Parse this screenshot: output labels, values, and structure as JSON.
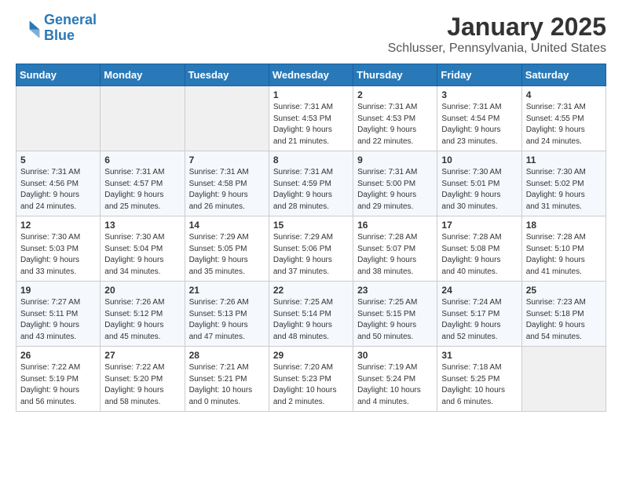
{
  "header": {
    "logo_line1": "General",
    "logo_line2": "Blue",
    "title": "January 2025",
    "subtitle": "Schlusser, Pennsylvania, United States"
  },
  "days_of_week": [
    "Sunday",
    "Monday",
    "Tuesday",
    "Wednesday",
    "Thursday",
    "Friday",
    "Saturday"
  ],
  "weeks": [
    [
      {
        "day": "",
        "content": ""
      },
      {
        "day": "",
        "content": ""
      },
      {
        "day": "",
        "content": ""
      },
      {
        "day": "1",
        "content": "Sunrise: 7:31 AM\nSunset: 4:53 PM\nDaylight: 9 hours\nand 21 minutes."
      },
      {
        "day": "2",
        "content": "Sunrise: 7:31 AM\nSunset: 4:53 PM\nDaylight: 9 hours\nand 22 minutes."
      },
      {
        "day": "3",
        "content": "Sunrise: 7:31 AM\nSunset: 4:54 PM\nDaylight: 9 hours\nand 23 minutes."
      },
      {
        "day": "4",
        "content": "Sunrise: 7:31 AM\nSunset: 4:55 PM\nDaylight: 9 hours\nand 24 minutes."
      }
    ],
    [
      {
        "day": "5",
        "content": "Sunrise: 7:31 AM\nSunset: 4:56 PM\nDaylight: 9 hours\nand 24 minutes."
      },
      {
        "day": "6",
        "content": "Sunrise: 7:31 AM\nSunset: 4:57 PM\nDaylight: 9 hours\nand 25 minutes."
      },
      {
        "day": "7",
        "content": "Sunrise: 7:31 AM\nSunset: 4:58 PM\nDaylight: 9 hours\nand 26 minutes."
      },
      {
        "day": "8",
        "content": "Sunrise: 7:31 AM\nSunset: 4:59 PM\nDaylight: 9 hours\nand 28 minutes."
      },
      {
        "day": "9",
        "content": "Sunrise: 7:31 AM\nSunset: 5:00 PM\nDaylight: 9 hours\nand 29 minutes."
      },
      {
        "day": "10",
        "content": "Sunrise: 7:30 AM\nSunset: 5:01 PM\nDaylight: 9 hours\nand 30 minutes."
      },
      {
        "day": "11",
        "content": "Sunrise: 7:30 AM\nSunset: 5:02 PM\nDaylight: 9 hours\nand 31 minutes."
      }
    ],
    [
      {
        "day": "12",
        "content": "Sunrise: 7:30 AM\nSunset: 5:03 PM\nDaylight: 9 hours\nand 33 minutes."
      },
      {
        "day": "13",
        "content": "Sunrise: 7:30 AM\nSunset: 5:04 PM\nDaylight: 9 hours\nand 34 minutes."
      },
      {
        "day": "14",
        "content": "Sunrise: 7:29 AM\nSunset: 5:05 PM\nDaylight: 9 hours\nand 35 minutes."
      },
      {
        "day": "15",
        "content": "Sunrise: 7:29 AM\nSunset: 5:06 PM\nDaylight: 9 hours\nand 37 minutes."
      },
      {
        "day": "16",
        "content": "Sunrise: 7:28 AM\nSunset: 5:07 PM\nDaylight: 9 hours\nand 38 minutes."
      },
      {
        "day": "17",
        "content": "Sunrise: 7:28 AM\nSunset: 5:08 PM\nDaylight: 9 hours\nand 40 minutes."
      },
      {
        "day": "18",
        "content": "Sunrise: 7:28 AM\nSunset: 5:10 PM\nDaylight: 9 hours\nand 41 minutes."
      }
    ],
    [
      {
        "day": "19",
        "content": "Sunrise: 7:27 AM\nSunset: 5:11 PM\nDaylight: 9 hours\nand 43 minutes."
      },
      {
        "day": "20",
        "content": "Sunrise: 7:26 AM\nSunset: 5:12 PM\nDaylight: 9 hours\nand 45 minutes."
      },
      {
        "day": "21",
        "content": "Sunrise: 7:26 AM\nSunset: 5:13 PM\nDaylight: 9 hours\nand 47 minutes."
      },
      {
        "day": "22",
        "content": "Sunrise: 7:25 AM\nSunset: 5:14 PM\nDaylight: 9 hours\nand 48 minutes."
      },
      {
        "day": "23",
        "content": "Sunrise: 7:25 AM\nSunset: 5:15 PM\nDaylight: 9 hours\nand 50 minutes."
      },
      {
        "day": "24",
        "content": "Sunrise: 7:24 AM\nSunset: 5:17 PM\nDaylight: 9 hours\nand 52 minutes."
      },
      {
        "day": "25",
        "content": "Sunrise: 7:23 AM\nSunset: 5:18 PM\nDaylight: 9 hours\nand 54 minutes."
      }
    ],
    [
      {
        "day": "26",
        "content": "Sunrise: 7:22 AM\nSunset: 5:19 PM\nDaylight: 9 hours\nand 56 minutes."
      },
      {
        "day": "27",
        "content": "Sunrise: 7:22 AM\nSunset: 5:20 PM\nDaylight: 9 hours\nand 58 minutes."
      },
      {
        "day": "28",
        "content": "Sunrise: 7:21 AM\nSunset: 5:21 PM\nDaylight: 10 hours\nand 0 minutes."
      },
      {
        "day": "29",
        "content": "Sunrise: 7:20 AM\nSunset: 5:23 PM\nDaylight: 10 hours\nand 2 minutes."
      },
      {
        "day": "30",
        "content": "Sunrise: 7:19 AM\nSunset: 5:24 PM\nDaylight: 10 hours\nand 4 minutes."
      },
      {
        "day": "31",
        "content": "Sunrise: 7:18 AM\nSunset: 5:25 PM\nDaylight: 10 hours\nand 6 minutes."
      },
      {
        "day": "",
        "content": ""
      }
    ]
  ]
}
